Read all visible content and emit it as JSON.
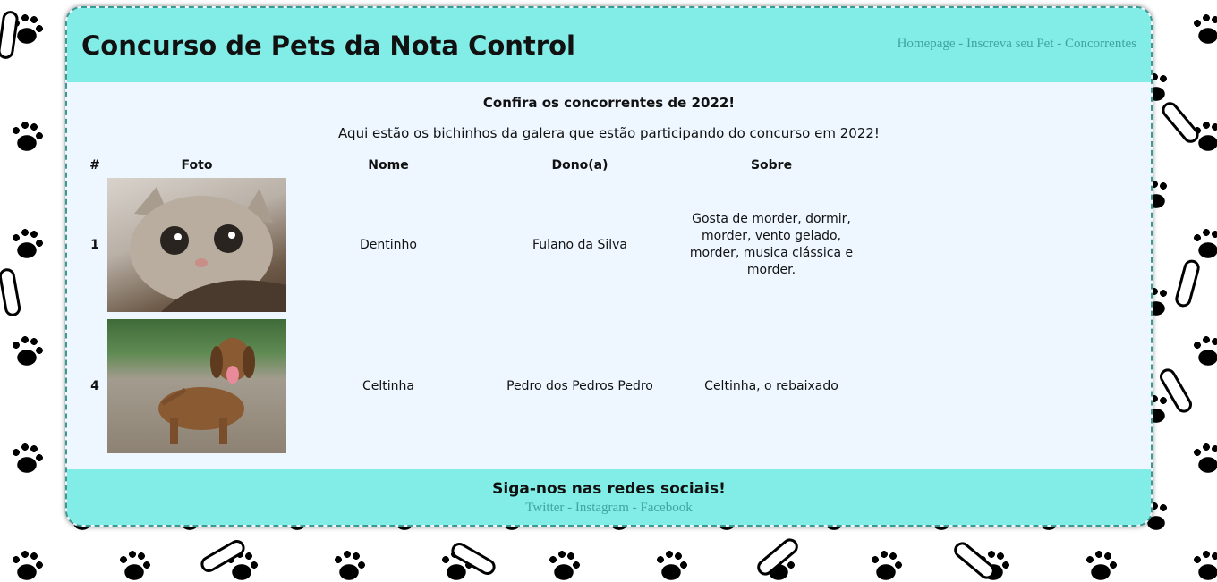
{
  "header": {
    "title": "Concurso de Pets da Nota Control",
    "nav": [
      {
        "label": "Homepage"
      },
      {
        "label": "Inscreva seu Pet"
      },
      {
        "label": "Concorrentes"
      }
    ],
    "separator": "-"
  },
  "main": {
    "title": "Confira os concorrentes de 2022!",
    "subtitle": "Aqui estão os bichinhos da galera que estão participando do concurso em 2022!",
    "table": {
      "headers": [
        "#",
        "Foto",
        "Nome",
        "Dono(a)",
        "Sobre"
      ],
      "rows": [
        {
          "id": "1",
          "nome": "Dentinho",
          "dono": "Fulano da Silva",
          "sobre": "Gosta de morder, dormir, morder, vento gelado, morder, musica clássica e morder.",
          "photo_icon": "cat-photo"
        },
        {
          "id": "4",
          "nome": "Celtinha",
          "dono": "Pedro dos Pedros Pedro",
          "sobre": "Celtinha, o rebaixado",
          "photo_icon": "dachshund-photo"
        }
      ]
    }
  },
  "footer": {
    "title": "Siga-nos nas redes sociais!",
    "links": [
      {
        "label": "Twitter"
      },
      {
        "label": "Instagram"
      },
      {
        "label": "Facebook"
      }
    ],
    "separator": "-"
  },
  "colors": {
    "teal_bar": "#82ede7",
    "link": "#3ea59e",
    "content_bg": "#eef6ff"
  }
}
